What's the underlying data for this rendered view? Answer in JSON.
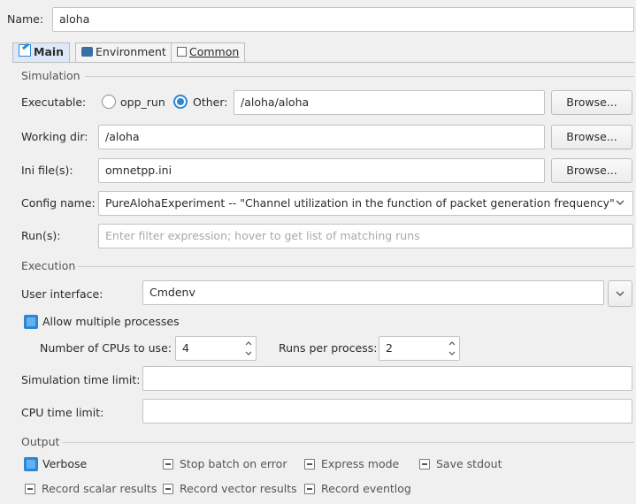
{
  "name_label": "Name:",
  "name_value": "aloha",
  "tabs": [
    {
      "label": "Main"
    },
    {
      "label": "Environment"
    },
    {
      "label": "Common"
    }
  ],
  "simulation": {
    "title": "Simulation",
    "executable_label": "Executable:",
    "opp_run_label": "opp_run",
    "other_label": "Other:",
    "executable_value": "/aloha/aloha",
    "working_dir_label": "Working dir:",
    "working_dir_value": "/aloha",
    "ini_label": "Ini file(s):",
    "ini_value": "omnetpp.ini",
    "config_label": "Config name:",
    "config_value": "PureAlohaExperiment -- \"Channel utilization in the function of packet generation frequency\"",
    "runs_label": "Run(s):",
    "runs_placeholder": "Enter filter expression; hover to get list of matching runs",
    "browse_label": "Browse..."
  },
  "execution": {
    "title": "Execution",
    "ui_label": "User interface:",
    "ui_value": "Cmdenv",
    "allow_multi_label": "Allow multiple processes",
    "cpus_label": "Number of CPUs to use:",
    "cpus_value": "4",
    "runs_per_label": "Runs per process:",
    "runs_per_value": "2",
    "sim_time_label": "Simulation time limit:",
    "cpu_time_label": "CPU time limit:"
  },
  "output": {
    "title": "Output",
    "verbose": "Verbose",
    "stop_batch": "Stop batch on error",
    "express": "Express mode",
    "save_stdout": "Save stdout",
    "record_scalar": "Record scalar results",
    "record_vector": "Record vector results",
    "record_eventlog": "Record eventlog"
  },
  "colors": {
    "accent": "#2d86d4",
    "tab_active": "#dde9f6"
  }
}
